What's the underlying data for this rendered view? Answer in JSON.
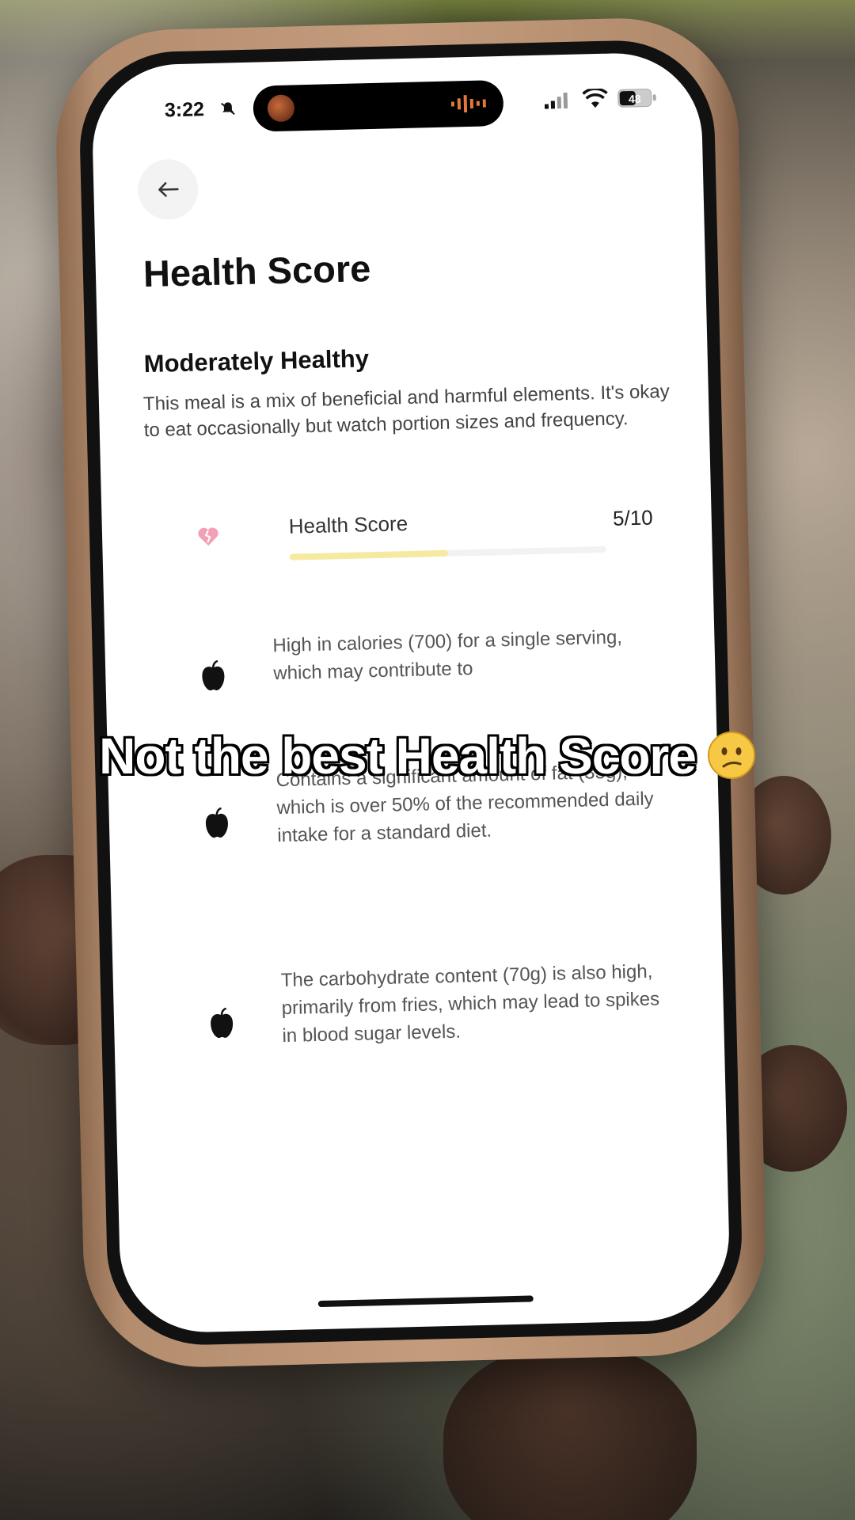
{
  "status_bar": {
    "time": "3:22",
    "battery": "48"
  },
  "page": {
    "title": "Health Score"
  },
  "summary": {
    "heading": "Moderately Healthy",
    "description": "This meal is a mix of beneficial and harmful elements. It's okay to eat occasionally but watch portion sizes and frequency."
  },
  "score": {
    "label": "Health Score",
    "value_text": "5/10",
    "value": 5,
    "max": 10,
    "bar_color": "#f6eaa0"
  },
  "items": [
    {
      "icon": "apple-icon",
      "text": "High in calories (700) for a single serving, which may contribute to"
    },
    {
      "icon": "apple-icon",
      "text": "Contains a significant amount of fat (35g), which is over 50% of the recommended daily intake for a standard diet."
    },
    {
      "icon": "apple-icon",
      "text": "The carbohydrate content (70g) is also high, primarily from fries, which may lead to spikes in blood sugar levels."
    }
  ],
  "overlay": {
    "caption": "Not the best Health Score",
    "emoji": "confused-face-emoji"
  },
  "colors": {
    "heart": "#f2a0b8",
    "case": "#c49c7d"
  }
}
